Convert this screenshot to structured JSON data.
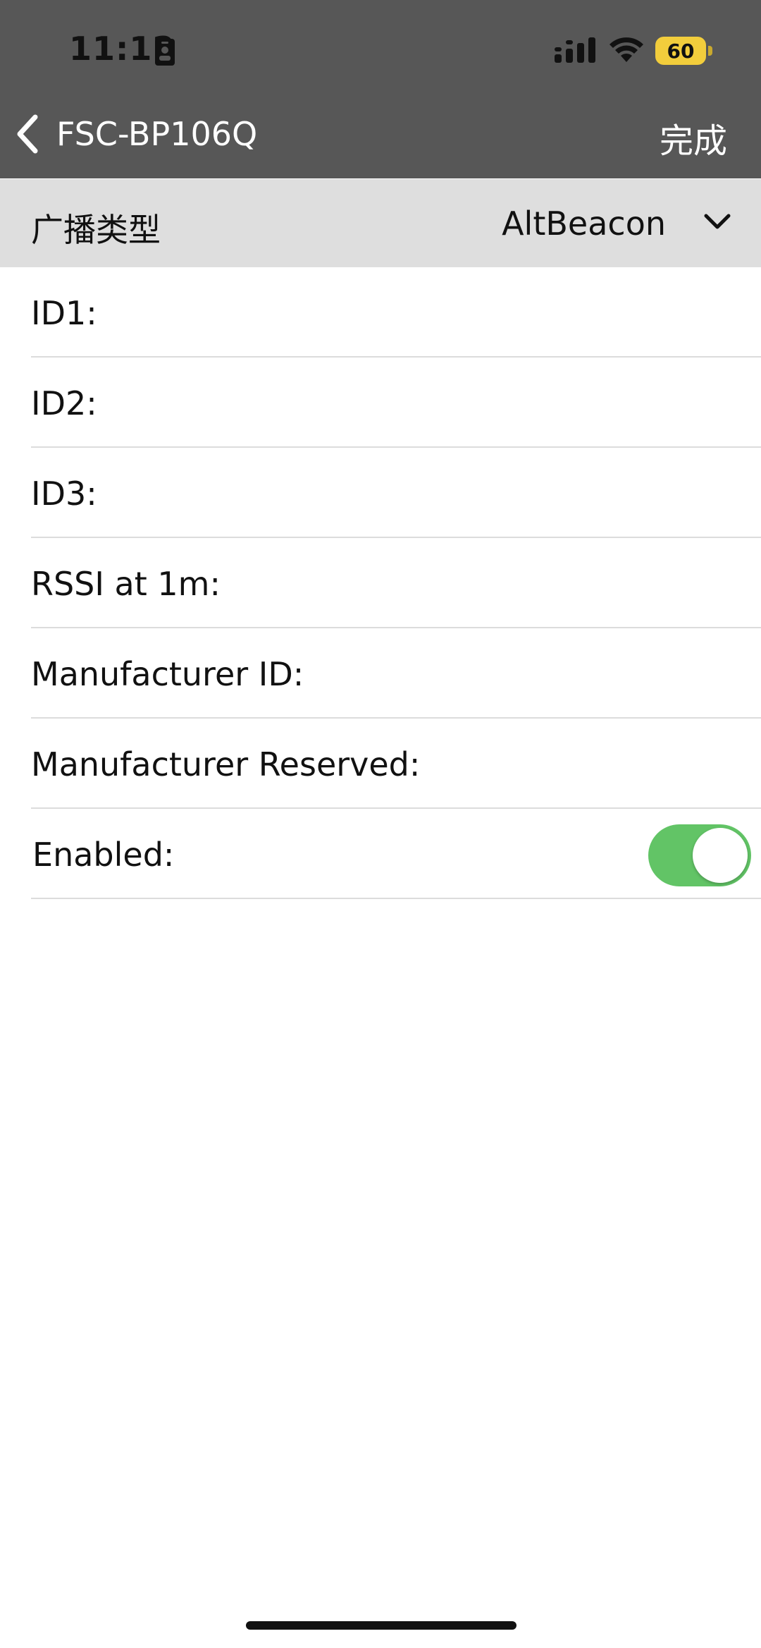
{
  "status_bar": {
    "time": "11:12",
    "battery_level": "60",
    "icons": [
      "id-card-icon",
      "signal-icon",
      "wifi-icon",
      "battery-icon"
    ]
  },
  "nav": {
    "back_title": "FSC-BP106Q",
    "done_label": "完成",
    "back_icon": "chevron-left-icon"
  },
  "broadcast_type": {
    "label": "广播类型",
    "value": "AltBeacon",
    "icon": "chevron-down-icon"
  },
  "fields": [
    {
      "label": "ID1:",
      "value": ""
    },
    {
      "label": "ID2:",
      "value": ""
    },
    {
      "label": "ID3:",
      "value": ""
    },
    {
      "label": "RSSI at 1m:",
      "value": ""
    },
    {
      "label": "Manufacturer ID:",
      "value": ""
    },
    {
      "label": "Manufacturer Reserved:",
      "value": ""
    }
  ],
  "enabled": {
    "label": "Enabled:",
    "on": true
  },
  "colors": {
    "header_bg": "#575757",
    "type_row_bg": "#dedede",
    "toggle_on": "#62c466",
    "battery": "#f2cd3c",
    "divider": "#dcdcdc"
  }
}
